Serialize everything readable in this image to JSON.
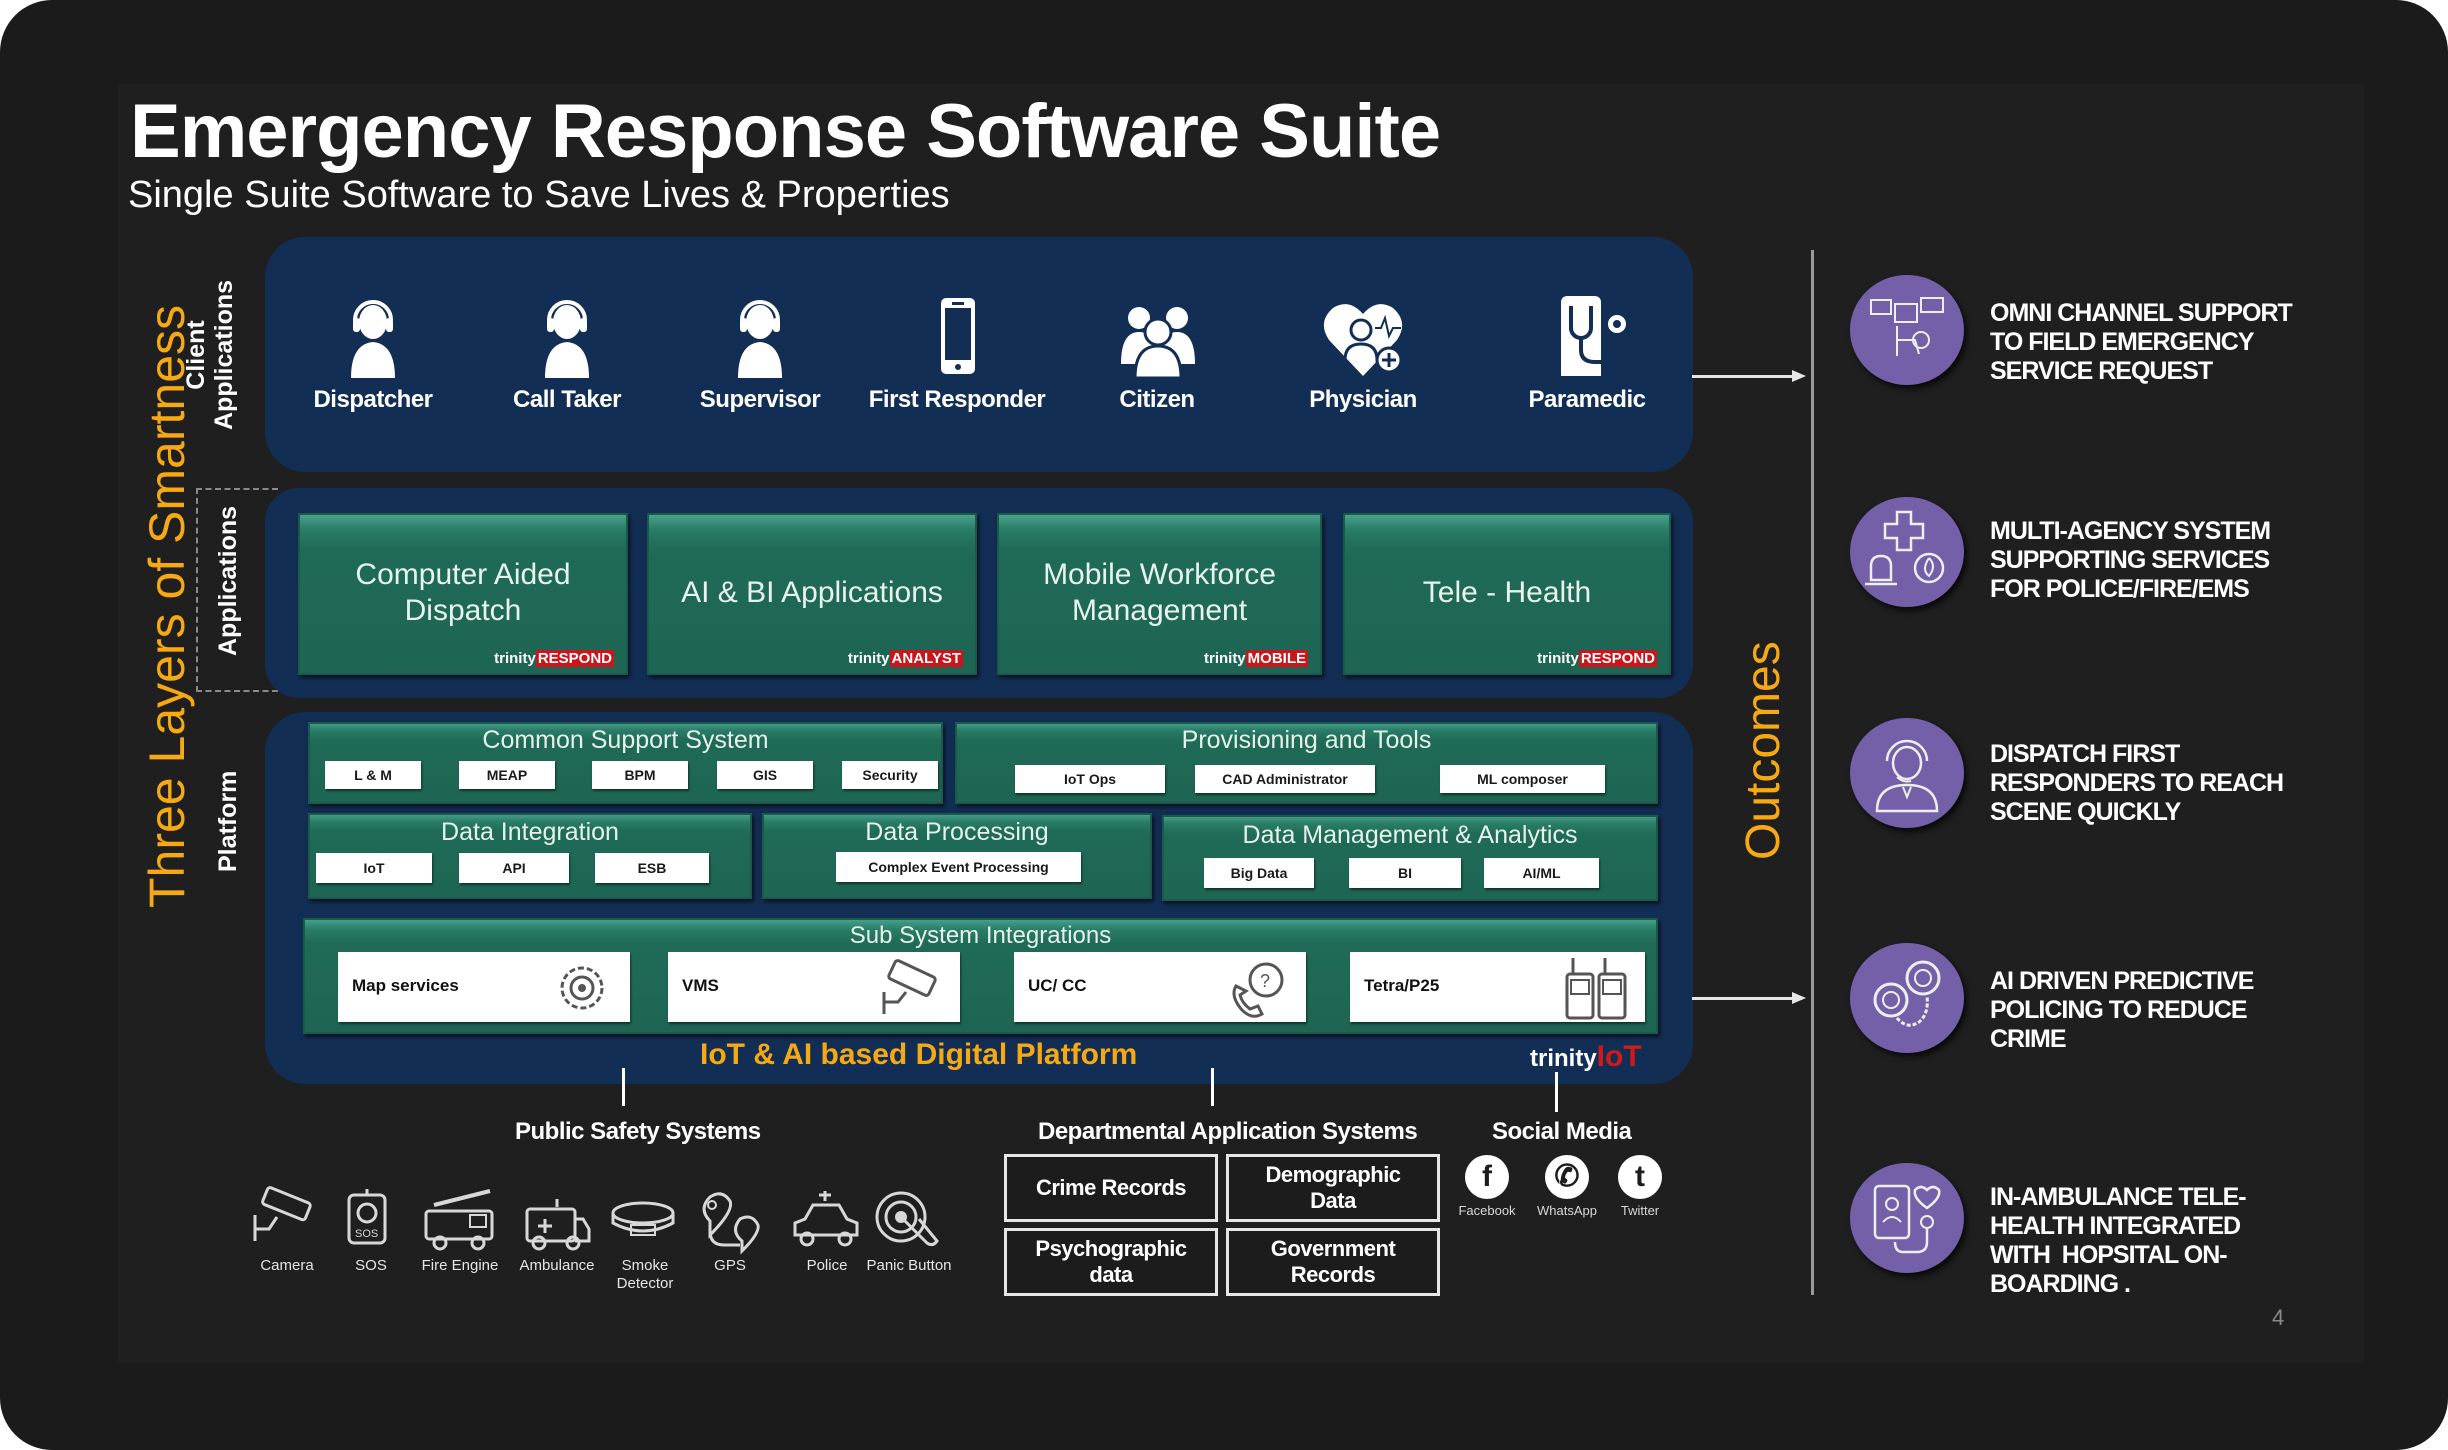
{
  "slide": {
    "title": "Emergency Response Software Suite",
    "subtitle": "Single Suite Software to Save Lives & Properties",
    "page_number": "4"
  },
  "side_labels": {
    "main": "Three Layers of Smartness",
    "client_line1": "Client",
    "client_line2": "Applications",
    "applications": "Applications",
    "platform": "Platform",
    "outcomes": "Outcomes"
  },
  "client_applications": [
    {
      "label": "Dispatcher",
      "icon": "headset-user-icon"
    },
    {
      "label": "Call Taker",
      "icon": "headset-user-icon"
    },
    {
      "label": "Supervisor",
      "icon": "headset-user-icon"
    },
    {
      "label": "First Responder",
      "icon": "smartphone-icon"
    },
    {
      "label": "Citizen",
      "icon": "group-icon"
    },
    {
      "label": "Physician",
      "icon": "doctor-heart-icon"
    },
    {
      "label": "Paramedic",
      "icon": "stethoscope-icon"
    }
  ],
  "applications": [
    {
      "title_line1": "Computer Aided",
      "title_line2": "Dispatch",
      "brand_prefix": "trinity",
      "brand_suffix": "RESPOND"
    },
    {
      "title_line1": "AI & BI Applications",
      "title_line2": "",
      "brand_prefix": "trinity",
      "brand_suffix": "ANALYST"
    },
    {
      "title_line1": "Mobile Workforce",
      "title_line2": "Management",
      "brand_prefix": "trinity",
      "brand_suffix": "MOBILE"
    },
    {
      "title_line1": "Tele - Health",
      "title_line2": "",
      "brand_prefix": "trinity",
      "brand_suffix": "RESPOND"
    }
  ],
  "platform": {
    "common_support": {
      "title": "Common Support System",
      "items": [
        "L & M",
        "MEAP",
        "BPM",
        "GIS",
        "Security"
      ]
    },
    "provisioning": {
      "title": "Provisioning and Tools",
      "items": [
        "IoT Ops",
        "CAD Administrator",
        "ML composer"
      ]
    },
    "data_integration": {
      "title": "Data Integration",
      "items": [
        "IoT",
        "API",
        "ESB"
      ]
    },
    "data_processing": {
      "title": "Data Processing",
      "items": [
        "Complex Event Processing"
      ]
    },
    "data_management": {
      "title": "Data Management & Analytics",
      "items": [
        "Big Data",
        "BI",
        "AI/ML"
      ]
    },
    "sub_system": {
      "title": "Sub System Integrations",
      "items": [
        {
          "label": "Map services",
          "icon": "map-gear-icon"
        },
        {
          "label": "VMS",
          "icon": "cctv-camera-icon"
        },
        {
          "label": "UC/ CC",
          "icon": "phone-support-icon"
        },
        {
          "label": "Tetra/P25",
          "icon": "radio-walkie-talkie-icon"
        }
      ]
    },
    "label": "IoT & AI based Digital Platform",
    "brand_prefix": "trinity",
    "brand_suffix": "IoT"
  },
  "public_safety": {
    "heading": "Public Safety Systems",
    "items": [
      {
        "label": "Camera",
        "icon": "camera-icon"
      },
      {
        "label": "SOS",
        "icon": "sos-icon"
      },
      {
        "label": "Fire Engine",
        "icon": "fire-engine-icon"
      },
      {
        "label": "Ambulance",
        "icon": "ambulance-icon"
      },
      {
        "label": "Smoke Detector",
        "icon": "smoke-detector-icon"
      },
      {
        "label": "GPS",
        "icon": "gps-icon"
      },
      {
        "label": "Police",
        "icon": "police-car-icon"
      },
      {
        "label": "Panic Button",
        "icon": "panic-button-icon"
      }
    ]
  },
  "departmental": {
    "heading": "Departmental Application Systems",
    "items": [
      {
        "line1": "Crime Records",
        "line2": ""
      },
      {
        "line1": "Demographic",
        "line2": "Data"
      },
      {
        "line1": "Psychographic",
        "line2": "data"
      },
      {
        "line1": "Government",
        "line2": "Records"
      }
    ]
  },
  "social_media": {
    "heading": "Social Media",
    "items": [
      {
        "label": "Facebook",
        "glyph": "f"
      },
      {
        "label": "WhatsApp",
        "glyph": "✆"
      },
      {
        "label": "Twitter",
        "glyph": "t"
      }
    ]
  },
  "outcomes": [
    {
      "lines": [
        "OMNI CHANNEL SUPPORT",
        "TO FIELD EMERGENCY",
        "SERVICE REQUEST"
      ],
      "icon": "omni-channel-icon"
    },
    {
      "lines": [
        "MULTI-AGENCY SYSTEM",
        "SUPPORTING SERVICES",
        "FOR POLICE/FIRE/EMS"
      ],
      "icon": "multi-agency-icon"
    },
    {
      "lines": [
        "DISPATCH FIRST",
        "RESPONDERS TO REACH",
        "SCENE QUICKLY"
      ],
      "icon": "dispatcher-headset-icon"
    },
    {
      "lines": [
        "AI DRIVEN PREDICTIVE",
        "POLICING TO REDUCE",
        "CRIME"
      ],
      "icon": "handcuffs-icon"
    },
    {
      "lines": [
        "IN-AMBULANCE TELE-",
        "HEALTH INTEGRATED",
        "WITH  HOPSITAL ON-",
        "BOARDING ."
      ],
      "icon": "telehealth-icon"
    }
  ],
  "colors": {
    "accent_orange": "#f6a912",
    "panel_navy": "#132e54",
    "box_green": "#1e6553",
    "outcome_purple": "#7360a8",
    "brand_red": "#c9161c"
  }
}
